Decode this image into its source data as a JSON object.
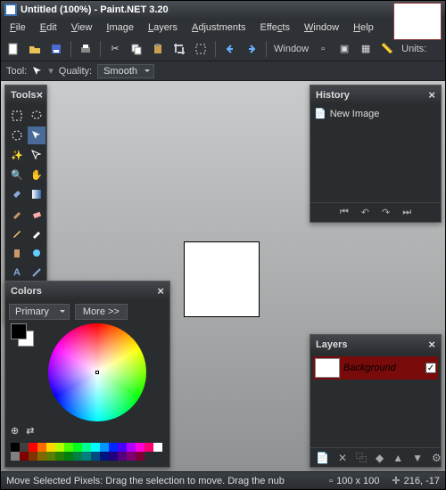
{
  "titlebar": {
    "title": "Untitled (100%) - Paint.NET 3.20"
  },
  "menu": [
    "File",
    "Edit",
    "View",
    "Image",
    "Layers",
    "Adjustments",
    "Effects",
    "Window",
    "Help"
  ],
  "toolbar": {
    "window_label": "Window",
    "units_label": "Units:"
  },
  "toolrow": {
    "tool_label": "Tool:",
    "quality_label": "Quality:",
    "quality_value": "Smooth"
  },
  "panels": {
    "tools": {
      "title": "Tools"
    },
    "history": {
      "title": "History",
      "item": "New Image"
    },
    "colors": {
      "title": "Colors",
      "selector": "Primary",
      "more": "More >>",
      "primary": "#000000",
      "secondary": "#ffffff",
      "palette": [
        "#000",
        "#404040",
        "#ff0000",
        "#ff6a00",
        "#ffd800",
        "#b6ff00",
        "#4cff00",
        "#00ff21",
        "#00ff90",
        "#00ffff",
        "#0094ff",
        "#0026ff",
        "#4800ff",
        "#b200ff",
        "#ff00dc",
        "#ff006e",
        "#fff",
        "#808080",
        "#7f0000",
        "#7f3300",
        "#7f6a00",
        "#5b7f00",
        "#267f00",
        "#007f0e",
        "#007f46",
        "#007f7f",
        "#004a7f",
        "#00137f",
        "#21007f",
        "#57007f",
        "#7f006e",
        "#7f0037"
      ]
    },
    "layers": {
      "title": "Layers",
      "item": "Background"
    }
  },
  "status": {
    "hint": "Move Selected Pixels: Drag the selection to move. Drag the nub",
    "dims": "100 x 100",
    "coords": "216, -17"
  }
}
